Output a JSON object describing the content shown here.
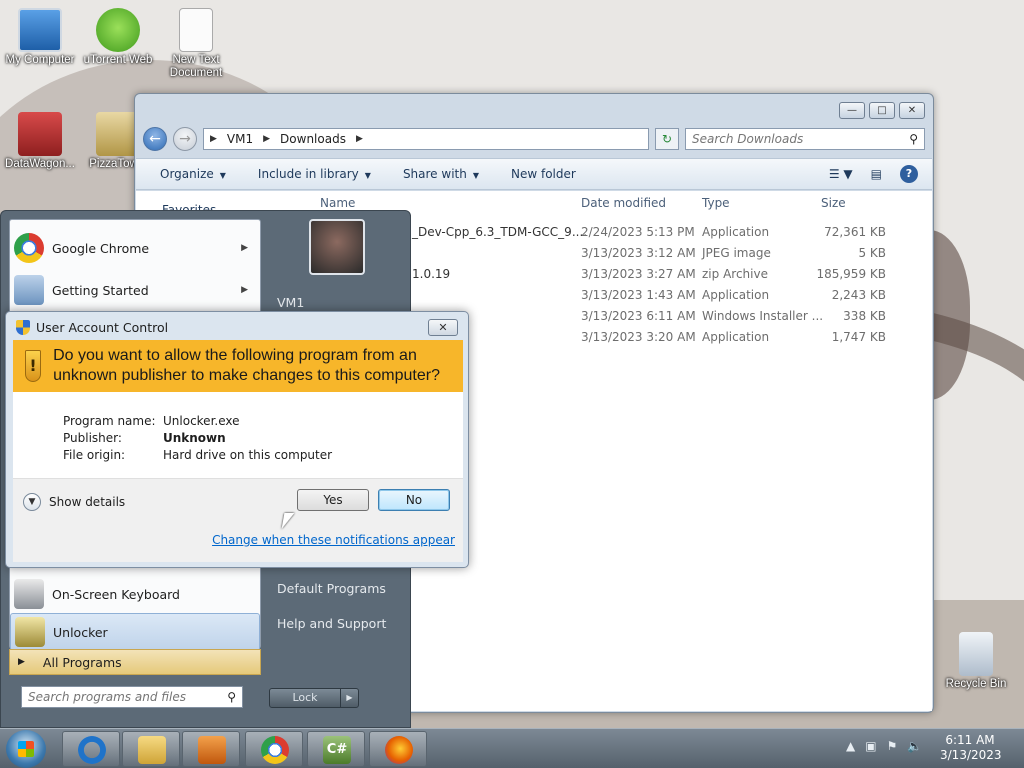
{
  "desktop": {
    "icons": [
      {
        "label": "My Computer",
        "icon": "computer-icon"
      },
      {
        "label": "uTorrent Web",
        "icon": "utorrent-icon"
      },
      {
        "label": "New Text Document",
        "icon": "text-document-icon"
      },
      {
        "label": "DataWagon...",
        "icon": "app-icon"
      },
      {
        "label": "PizzaTow...",
        "icon": "app-icon"
      },
      {
        "label": "Recycle Bin",
        "icon": "recycle-bin-icon"
      }
    ]
  },
  "explorer": {
    "breadcrumb": [
      "VM1",
      "Downloads"
    ],
    "search_placeholder": "Search Downloads",
    "toolbar": {
      "organize": "Organize",
      "include": "Include in library",
      "share": "Share with",
      "new_folder": "New folder"
    },
    "nav_favorites": "Favorites",
    "columns": {
      "name": "Name",
      "date": "Date modified",
      "type": "Type",
      "size": "Size"
    },
    "files": [
      {
        "name": "_Dev-Cpp_6.3_TDM-GCC_9....",
        "date": "2/24/2023 5:13 PM",
        "type": "Application",
        "size": "72,361 KB"
      },
      {
        "name": "",
        "date": "3/13/2023 3:12 AM",
        "type": "JPEG image",
        "size": "5 KB"
      },
      {
        "name": "1.0.19",
        "date": "3/13/2023 3:27 AM",
        "type": "zip Archive",
        "size": "185,959 KB"
      },
      {
        "name": "",
        "date": "3/13/2023 1:43 AM",
        "type": "Application",
        "size": "2,243 KB"
      },
      {
        "name": "",
        "date": "3/13/2023 6:11 AM",
        "type": "Windows Installer ...",
        "size": "338 KB"
      },
      {
        "name": "",
        "date": "3/13/2023 3:20 AM",
        "type": "Application",
        "size": "1,747 KB"
      }
    ]
  },
  "start_menu": {
    "programs": [
      {
        "label": "Google Chrome",
        "icon": "chrome-icon",
        "submenu": true
      },
      {
        "label": "Getting Started",
        "icon": "getting-started-icon",
        "submenu": true
      },
      {
        "label": "On-Screen Keyboard",
        "icon": "keyboard-icon",
        "submenu": false
      },
      {
        "label": "Unlocker",
        "icon": "unlocker-icon",
        "submenu": false
      }
    ],
    "all_programs": "All Programs",
    "search_placeholder": "Search programs and files",
    "right": {
      "user": "VM1",
      "default_programs": "Default Programs",
      "help": "Help and Support"
    },
    "lock_label": "Lock"
  },
  "uac": {
    "title": "User Account Control",
    "question": "Do you want to allow the following program from an unknown publisher to make changes to this computer?",
    "fields": [
      {
        "key": "Program name:",
        "value": "Unlocker.exe"
      },
      {
        "key": "Publisher:",
        "value": "Unknown"
      },
      {
        "key": "File origin:",
        "value": "Hard drive on this computer"
      }
    ],
    "show_details": "Show details",
    "yes": "Yes",
    "no": "No",
    "link": "Change when these notifications appear"
  },
  "taskbar": {
    "apps": [
      "internet-explorer-icon",
      "folder-icon",
      "media-player-icon",
      "chrome-icon",
      "csharp-icon",
      "firefox-icon"
    ],
    "time": "6:11 AM",
    "date": "3/13/2023"
  }
}
